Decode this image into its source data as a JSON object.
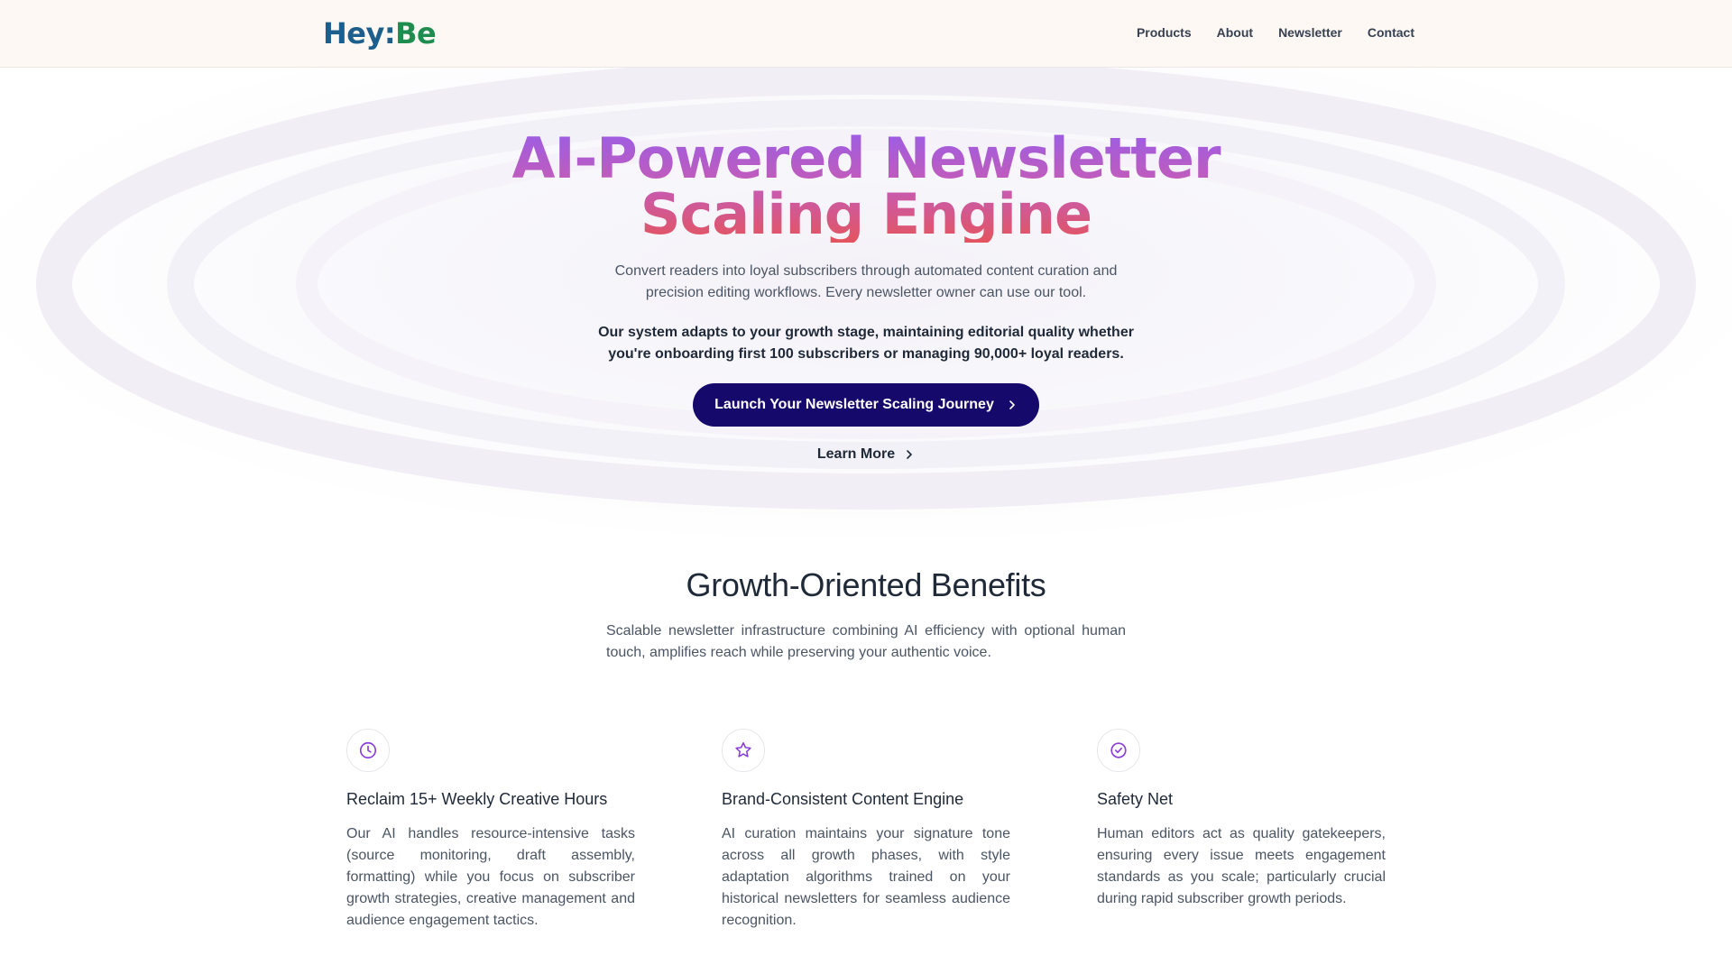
{
  "brand": {
    "logo_part1": "Hey:",
    "logo_part2": "Be",
    "logo_color1": "#1c5f8c",
    "logo_color2": "#1e8d4f"
  },
  "nav": {
    "items": [
      {
        "label": "Products"
      },
      {
        "label": "About"
      },
      {
        "label": "Newsletter"
      },
      {
        "label": "Contact"
      }
    ]
  },
  "hero": {
    "title_line1": "AI-Powered Newsletter",
    "title_line2": "Scaling Engine",
    "subtitle": "Convert readers into loyal subscribers through automated content curation and precision editing workflows. Every newsletter owner can use our tool.",
    "subtitle_bold": "Our system adapts to your growth stage, maintaining editorial quality whether you're onboarding first 100 subscribers or managing 90,000+ loyal readers.",
    "cta_label": "Launch Your Newsletter Scaling Journey",
    "learn_more_label": "Learn More",
    "cta_color": "#15096b",
    "gradient_colors": [
      "#9b5de5",
      "#c45cb8",
      "#e4545e"
    ]
  },
  "benefits": {
    "heading": "Growth-Oriented Benefits",
    "intro": "Scalable newsletter infrastructure combining AI efficiency with optional human touch, amplifies reach while preserving your authentic voice.",
    "icon_color": "#8b3fd9",
    "cards": [
      {
        "icon": "clock-icon",
        "title": "Reclaim 15+ Weekly Creative Hours",
        "body": "Our AI handles resource-intensive tasks (source monitoring, draft assembly, formatting) while you focus on subscriber growth strategies, creative management and audience engagement tactics."
      },
      {
        "icon": "star-icon",
        "title": "Brand-Consistent Content Engine",
        "body": "AI curation maintains your signature tone across all growth phases, with style adaptation algorithms trained on your historical newsletters for seamless audience recognition."
      },
      {
        "icon": "check-circle-icon",
        "title": "Safety Net",
        "body": "Human editors act as quality gatekeepers, ensuring every issue meets engagement standards as you scale; particularly crucial during rapid subscriber growth periods."
      }
    ]
  }
}
